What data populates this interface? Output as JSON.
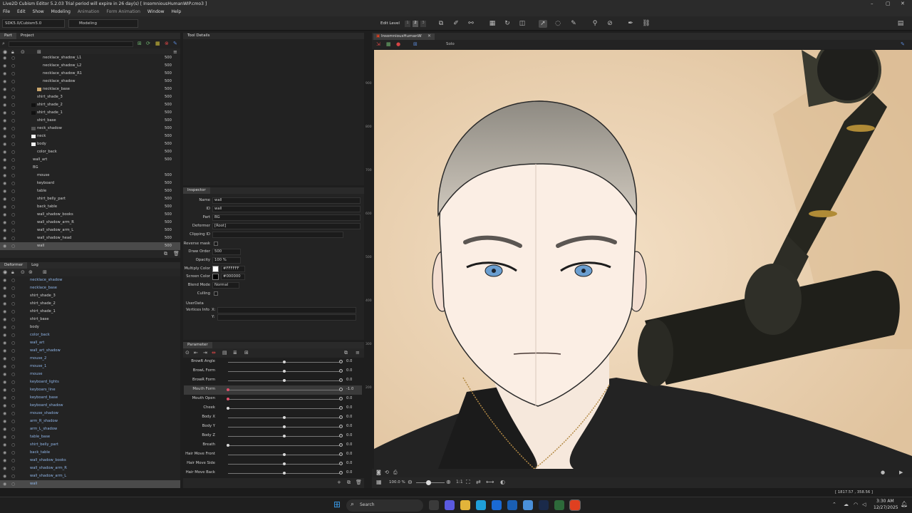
{
  "window": {
    "title": "Live2D Cubism Editor 5.2.03   Trial period will expire in 26 day(s)   [ InsomniousHumanWIP.cmo3 ]"
  },
  "menu": [
    "File",
    "Edit",
    "Show",
    "Modeling",
    "Animation",
    "Form Animation",
    "Window",
    "Help"
  ],
  "toolbar": {
    "sdk": "SDK5.0/Cubism5.0",
    "mode": "Modeling",
    "edit_level_label": "Edit Level",
    "edit_levels": [
      "1",
      "2",
      "3"
    ]
  },
  "part_panel": {
    "tabs": [
      "Part",
      "Project"
    ],
    "rows": [
      {
        "name": "necklace_shadow_L1",
        "value": "500"
      },
      {
        "name": "necklace_shadow_L2",
        "value": "500"
      },
      {
        "name": "necklace_shadow_R1",
        "value": "500"
      },
      {
        "name": "necklace_shadow",
        "value": "500"
      },
      {
        "name": "necklace_base",
        "value": "500"
      },
      {
        "name": "shirt_shade_3",
        "value": "500"
      },
      {
        "name": "shirt_shade_2",
        "value": "500"
      },
      {
        "name": "shirt_shade_1",
        "value": "500"
      },
      {
        "name": "shirt_base",
        "value": "500"
      },
      {
        "name": "neck_shadow",
        "value": "500"
      },
      {
        "name": "neck",
        "value": "500"
      },
      {
        "name": "body",
        "value": "500"
      },
      {
        "name": "color_back",
        "value": "500"
      },
      {
        "name": "wall_art",
        "value": "500"
      },
      {
        "name": "BG",
        "value": ""
      },
      {
        "name": "mouse",
        "value": "500"
      },
      {
        "name": "keyboard",
        "value": "500"
      },
      {
        "name": "table",
        "value": "500"
      },
      {
        "name": "shirt_belly_part",
        "value": "500"
      },
      {
        "name": "back_table",
        "value": "500"
      },
      {
        "name": "wall_shadow_books",
        "value": "500"
      },
      {
        "name": "wall_shadow_arm_R",
        "value": "500"
      },
      {
        "name": "wall_shadow_arm_L",
        "value": "500"
      },
      {
        "name": "wall_shadow_head",
        "value": "500"
      },
      {
        "name": "wall",
        "value": "500"
      }
    ]
  },
  "deformer_panel": {
    "tabs": [
      "Deformer",
      "Log"
    ],
    "rows": [
      "necklace_shadow",
      "necklace_base",
      "shirt_shade_3",
      "shirt_shade_2",
      "shirt_shade_1",
      "shirt_base",
      "body",
      "color_back",
      "wall_art",
      "wall_art_shadow",
      "mouse_2",
      "mouse_1",
      "mouse",
      "keyboard_lights",
      "keyboars_line",
      "keyboard_base",
      "keyboard_shadow",
      "mouse_shadow",
      "arm_R_shadow",
      "arm_L_shadow",
      "table_base",
      "shirt_belly_part",
      "back_table",
      "wall_shadow_books",
      "wall_shadow_arm_R",
      "wall_shadow_arm_L",
      "wall"
    ]
  },
  "tool_details": {
    "title": "Tool Details"
  },
  "inspector": {
    "title": "Inspector",
    "fields": [
      {
        "label": "Name",
        "value": "wall"
      },
      {
        "label": "ID",
        "value": "wall"
      },
      {
        "label": "Part",
        "value": "BG"
      },
      {
        "label": "Deformer",
        "value": "[Root]"
      },
      {
        "label": "Clipping ID",
        "value": ""
      },
      {
        "label": "Reverse mask",
        "value": ""
      },
      {
        "label": "Draw Order",
        "value": "500"
      },
      {
        "label": "Opacity",
        "value": "100 %"
      },
      {
        "label": "Multiply Color",
        "value": "#FFFFFF"
      },
      {
        "label": "Screen Color",
        "value": "#000000"
      },
      {
        "label": "Blend Mode",
        "value": "Normal"
      },
      {
        "label": "Culling",
        "value": ""
      }
    ],
    "userdata": "UserData",
    "vertices_label": "Vertices Info",
    "x": "X:",
    "y": "Y:"
  },
  "parameter": {
    "title": "Parameter",
    "rows": [
      {
        "label": "BrowR Angle",
        "value": "0.0",
        "level": 0.5
      },
      {
        "label": "BrowL Form",
        "value": "0.0",
        "level": 0.5
      },
      {
        "label": "BrowR Form",
        "value": "0.0",
        "level": 0.5
      },
      {
        "label": "Mouth Form",
        "value": "-1.0",
        "level": 0.0
      },
      {
        "label": "Mouth Open",
        "value": "0.0",
        "level": 0.0
      },
      {
        "label": "Cheek",
        "value": "0.0",
        "level": 0.0
      },
      {
        "label": "Body X",
        "value": "0.0",
        "level": 0.5
      },
      {
        "label": "Body Y",
        "value": "0.0",
        "level": 0.5
      },
      {
        "label": "Body Z",
        "value": "0.0",
        "level": 0.5
      },
      {
        "label": "Breath",
        "value": "0.0",
        "level": 0.0
      },
      {
        "label": "Hair Move Front",
        "value": "0.0",
        "level": 0.5
      },
      {
        "label": "Hair Move Side",
        "value": "0.0",
        "level": 0.5
      },
      {
        "label": "Hair Move Back",
        "value": "0.0",
        "level": 0.5
      }
    ]
  },
  "canvas": {
    "tab": "InsomniousHumanW",
    "solo": "Solo",
    "zoom": "100.0 %",
    "ruler": [
      "900",
      "800",
      "700",
      "600",
      "500",
      "400",
      "300",
      "200"
    ],
    "status": "[ 1817.57 , 358.56 ]"
  },
  "taskbar": {
    "search": "Search",
    "time": "3:30 AM",
    "date": "12/27/2025"
  },
  "colors": {
    "bg": "#1e1e1e",
    "panel": "#262626",
    "canvas_bg": "#e9d2b4",
    "accent": "#e04020"
  }
}
